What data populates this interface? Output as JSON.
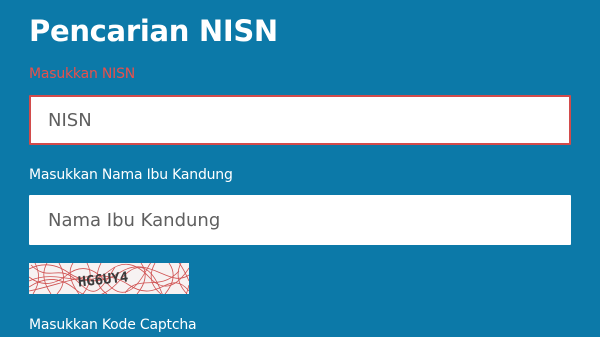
{
  "form": {
    "title": "Pencarian NISN",
    "nisn": {
      "label": "Masukkan NISN",
      "placeholder": "NISN",
      "value": ""
    },
    "mother_name": {
      "label": "Masukkan Nama Ibu Kandung",
      "placeholder": "Nama Ibu Kandung",
      "value": ""
    },
    "captcha": {
      "code": "HG6UY4",
      "label": "Masukkan Kode Captcha"
    }
  },
  "colors": {
    "background": "#0c79a8",
    "error": "#e8504b",
    "captcha_noise": "#c93535"
  }
}
